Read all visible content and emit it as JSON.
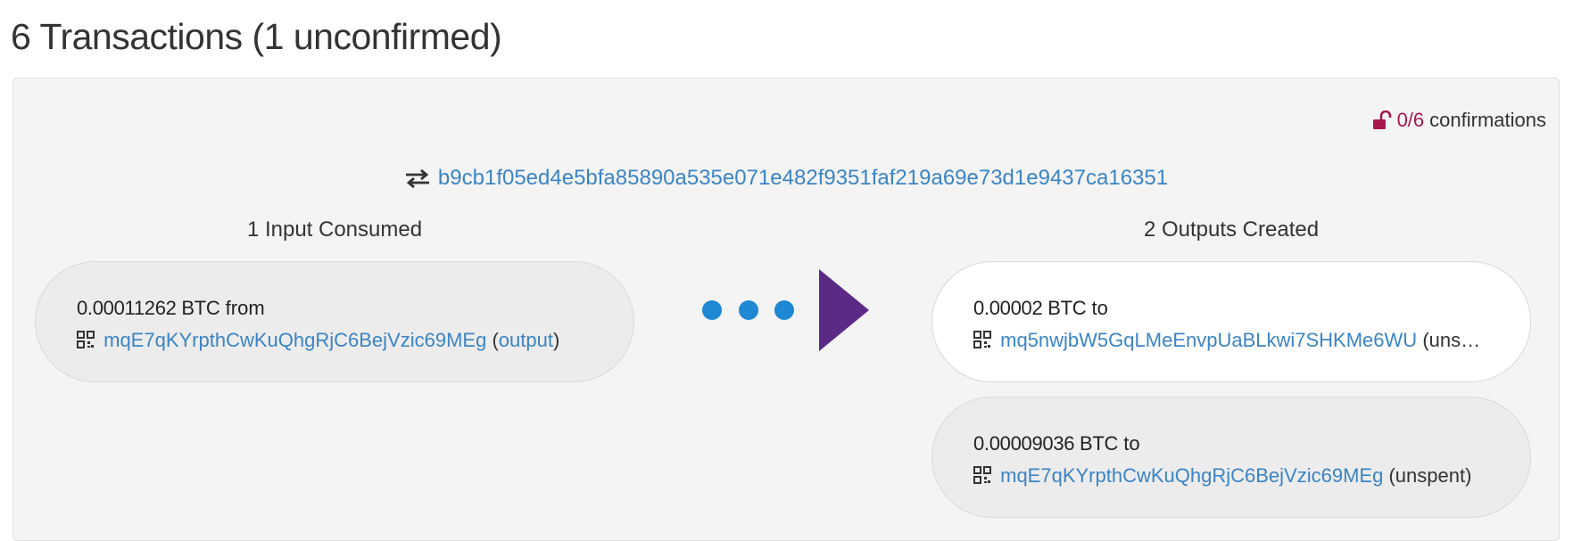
{
  "header": {
    "title": "6 Transactions (1 unconfirmed)"
  },
  "transaction": {
    "confirmations_count": "0/6",
    "confirmations_label": "confirmations",
    "txid": "b9cb1f05ed4e5bfa85890a535e071e482f9351faf219a69e73d1e9437ca16351",
    "inputs_title": "1 Input Consumed",
    "outputs_title": "2 Outputs Created",
    "inputs": [
      {
        "amount": "0.00011262 BTC",
        "direction": "from",
        "address": "mqE7qKYrpthCwKuQhgRjC6BejVzic69MEg",
        "status_open": "(",
        "status_link": "output",
        "status_close": ")"
      }
    ],
    "outputs": [
      {
        "amount": "0.00002 BTC",
        "direction": "to",
        "address": "mq5nwjbW5GqLMeEnvpUaBLkwi7SHKMe6WU",
        "status": "(uns…"
      },
      {
        "amount": "0.00009036 BTC",
        "direction": "to",
        "address": "mqE7qKYrpthCwKuQhgRjC6BejVzic69MEg",
        "status": "(unspent)"
      }
    ]
  },
  "icons": {
    "unlock": "unlock-icon",
    "exchange": "exchange-arrows-icon",
    "qr": "qr-code-icon",
    "flow": "dots-arrow-icon"
  },
  "colors": {
    "link": "#3c84c4",
    "unconfirmed": "#a8174e",
    "dots": "#1e88d4",
    "arrow": "#5b2a86",
    "panel_bg": "#f4f4f4"
  }
}
